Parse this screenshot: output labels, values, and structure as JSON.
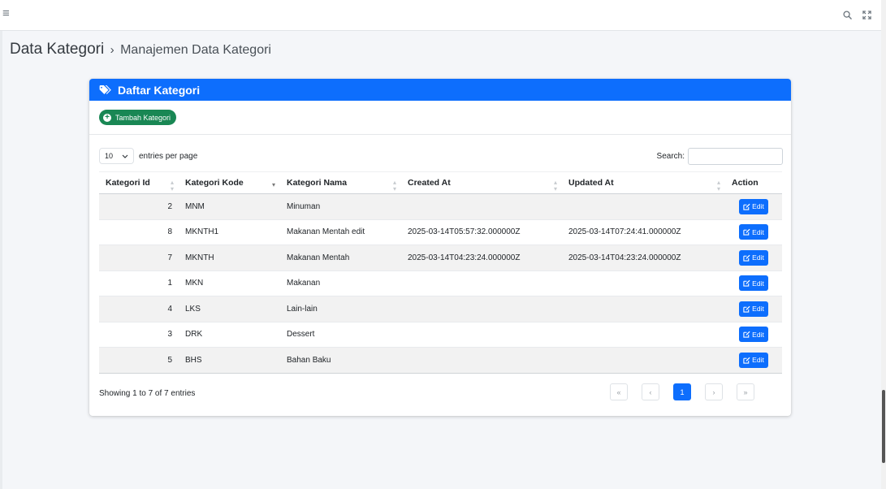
{
  "topbar": {
    "menu_icon": "hamburger-icon",
    "search_icon": "search-icon",
    "expand_icon": "expand-icon"
  },
  "header": {
    "title": "Data Kategori",
    "separator": "›",
    "subtitle": "Manajemen Data Kategori"
  },
  "card": {
    "title": "Daftar Kategori",
    "title_icon": "tags-icon",
    "add_button": "Tambah Kategori",
    "accent": "#0d6efd",
    "add_color": "#198754"
  },
  "datatable": {
    "length_value": "10",
    "length_label": "entries per page",
    "search_label": "Search:",
    "search_value": "",
    "columns": [
      "Kategori Id",
      "Kategori Kode",
      "Kategori Nama",
      "Created At",
      "Updated At",
      "Action"
    ],
    "rows": [
      {
        "id": "2",
        "kode": "MNM",
        "nama": "Minuman",
        "created": "",
        "updated": "",
        "action": "Edit"
      },
      {
        "id": "8",
        "kode": "MKNTH1",
        "nama": "Makanan Mentah edit",
        "created": "2025-03-14T05:57:32.000000Z",
        "updated": "2025-03-14T07:24:41.000000Z",
        "action": "Edit"
      },
      {
        "id": "7",
        "kode": "MKNTH",
        "nama": "Makanan Mentah",
        "created": "2025-03-14T04:23:24.000000Z",
        "updated": "2025-03-14T04:23:24.000000Z",
        "action": "Edit"
      },
      {
        "id": "1",
        "kode": "MKN",
        "nama": "Makanan",
        "created": "",
        "updated": "",
        "action": "Edit"
      },
      {
        "id": "4",
        "kode": "LKS",
        "nama": "Lain-lain",
        "created": "",
        "updated": "",
        "action": "Edit"
      },
      {
        "id": "3",
        "kode": "DRK",
        "nama": "Dessert",
        "created": "",
        "updated": "",
        "action": "Edit"
      },
      {
        "id": "5",
        "kode": "BHS",
        "nama": "Bahan Baku",
        "created": "",
        "updated": "",
        "action": "Edit"
      }
    ],
    "info": "Showing 1 to 7 of 7 entries",
    "pagination": {
      "first": "«",
      "prev": "‹",
      "current": "1",
      "next": "›",
      "last": "»"
    }
  }
}
